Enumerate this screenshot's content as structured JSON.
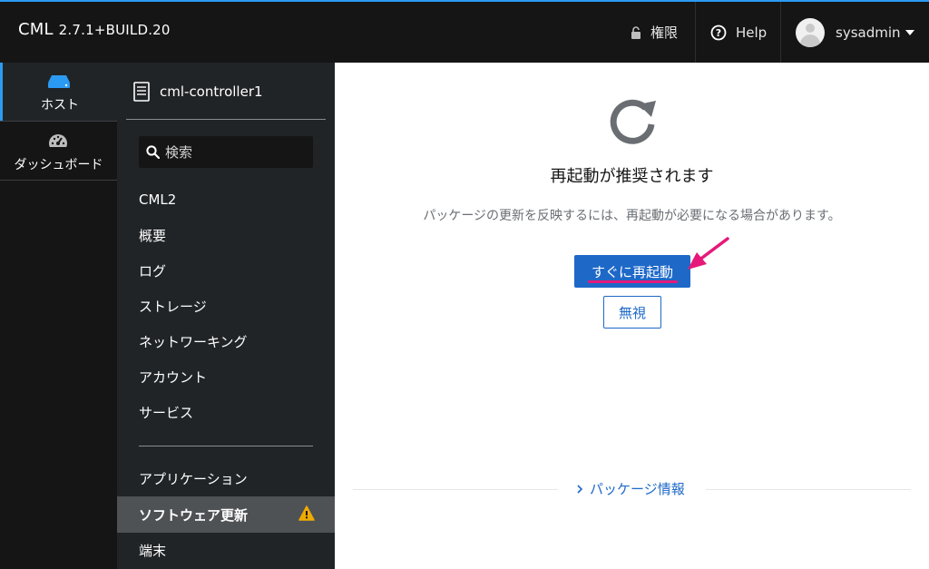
{
  "header": {
    "app_name": "CML",
    "version": "2.7.1+BUILD.20",
    "permissions_label": "権限",
    "help_label": "Help",
    "user_name": "sysadmin",
    "accent_color": "#2b9af3"
  },
  "rail": {
    "items": [
      {
        "label": "ホスト",
        "icon": "server-icon",
        "active": true
      },
      {
        "label": "ダッシュボード",
        "icon": "dashboard-gauge-icon",
        "active": false
      }
    ]
  },
  "subnav": {
    "device_name": "cml-controller1",
    "search_placeholder": "検索",
    "items": [
      {
        "label": "CML2"
      },
      {
        "label": "概要"
      },
      {
        "label": "ログ"
      },
      {
        "label": "ストレージ"
      },
      {
        "label": "ネットワーキング"
      },
      {
        "label": "アカウント"
      },
      {
        "label": "サービス"
      }
    ],
    "items2": [
      {
        "label": "アプリケーション",
        "active": false
      },
      {
        "label": "ソフトウェア更新",
        "active": true,
        "badge": "warning-icon"
      },
      {
        "label": "端末",
        "active": false
      }
    ]
  },
  "main": {
    "title": "再起動が推奨されます",
    "description": "パッケージの更新を反映するには、再起動が必要になる場合があります。",
    "restart_button": "すぐに再起動",
    "ignore_button": "無視",
    "packages_link": "パッケージ情報",
    "primary_color": "#1e69c8",
    "highlight_color": "#e6197a"
  }
}
